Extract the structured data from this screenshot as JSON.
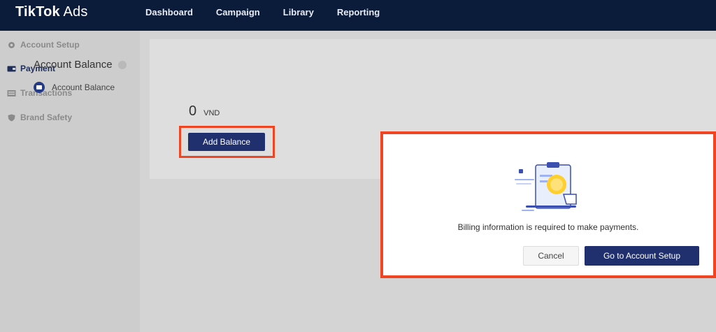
{
  "header": {
    "logo_brand": "TikTok",
    "logo_product": "Ads",
    "nav": [
      {
        "label": "Dashboard"
      },
      {
        "label": "Campaign"
      },
      {
        "label": "Library"
      },
      {
        "label": "Reporting"
      }
    ]
  },
  "sidebar": {
    "items": [
      {
        "label": "Account Setup",
        "icon": "gear-icon"
      },
      {
        "label": "Payment",
        "icon": "wallet-icon",
        "active": true
      },
      {
        "label": "Transactions",
        "icon": "list-icon"
      },
      {
        "label": "Brand Safety",
        "icon": "shield-icon"
      }
    ]
  },
  "main": {
    "title": "Account Balance",
    "balance_option_label": "Account Balance",
    "amount": "0",
    "currency": "VND",
    "add_balance_label": "Add Balance"
  },
  "modal": {
    "message": "Billing information is required to make payments.",
    "cancel_label": "Cancel",
    "confirm_label": "Go to Account Setup"
  },
  "colors": {
    "header_bg": "#0b1b3a",
    "primary_button": "#20306e",
    "highlight_border": "#f04523"
  }
}
